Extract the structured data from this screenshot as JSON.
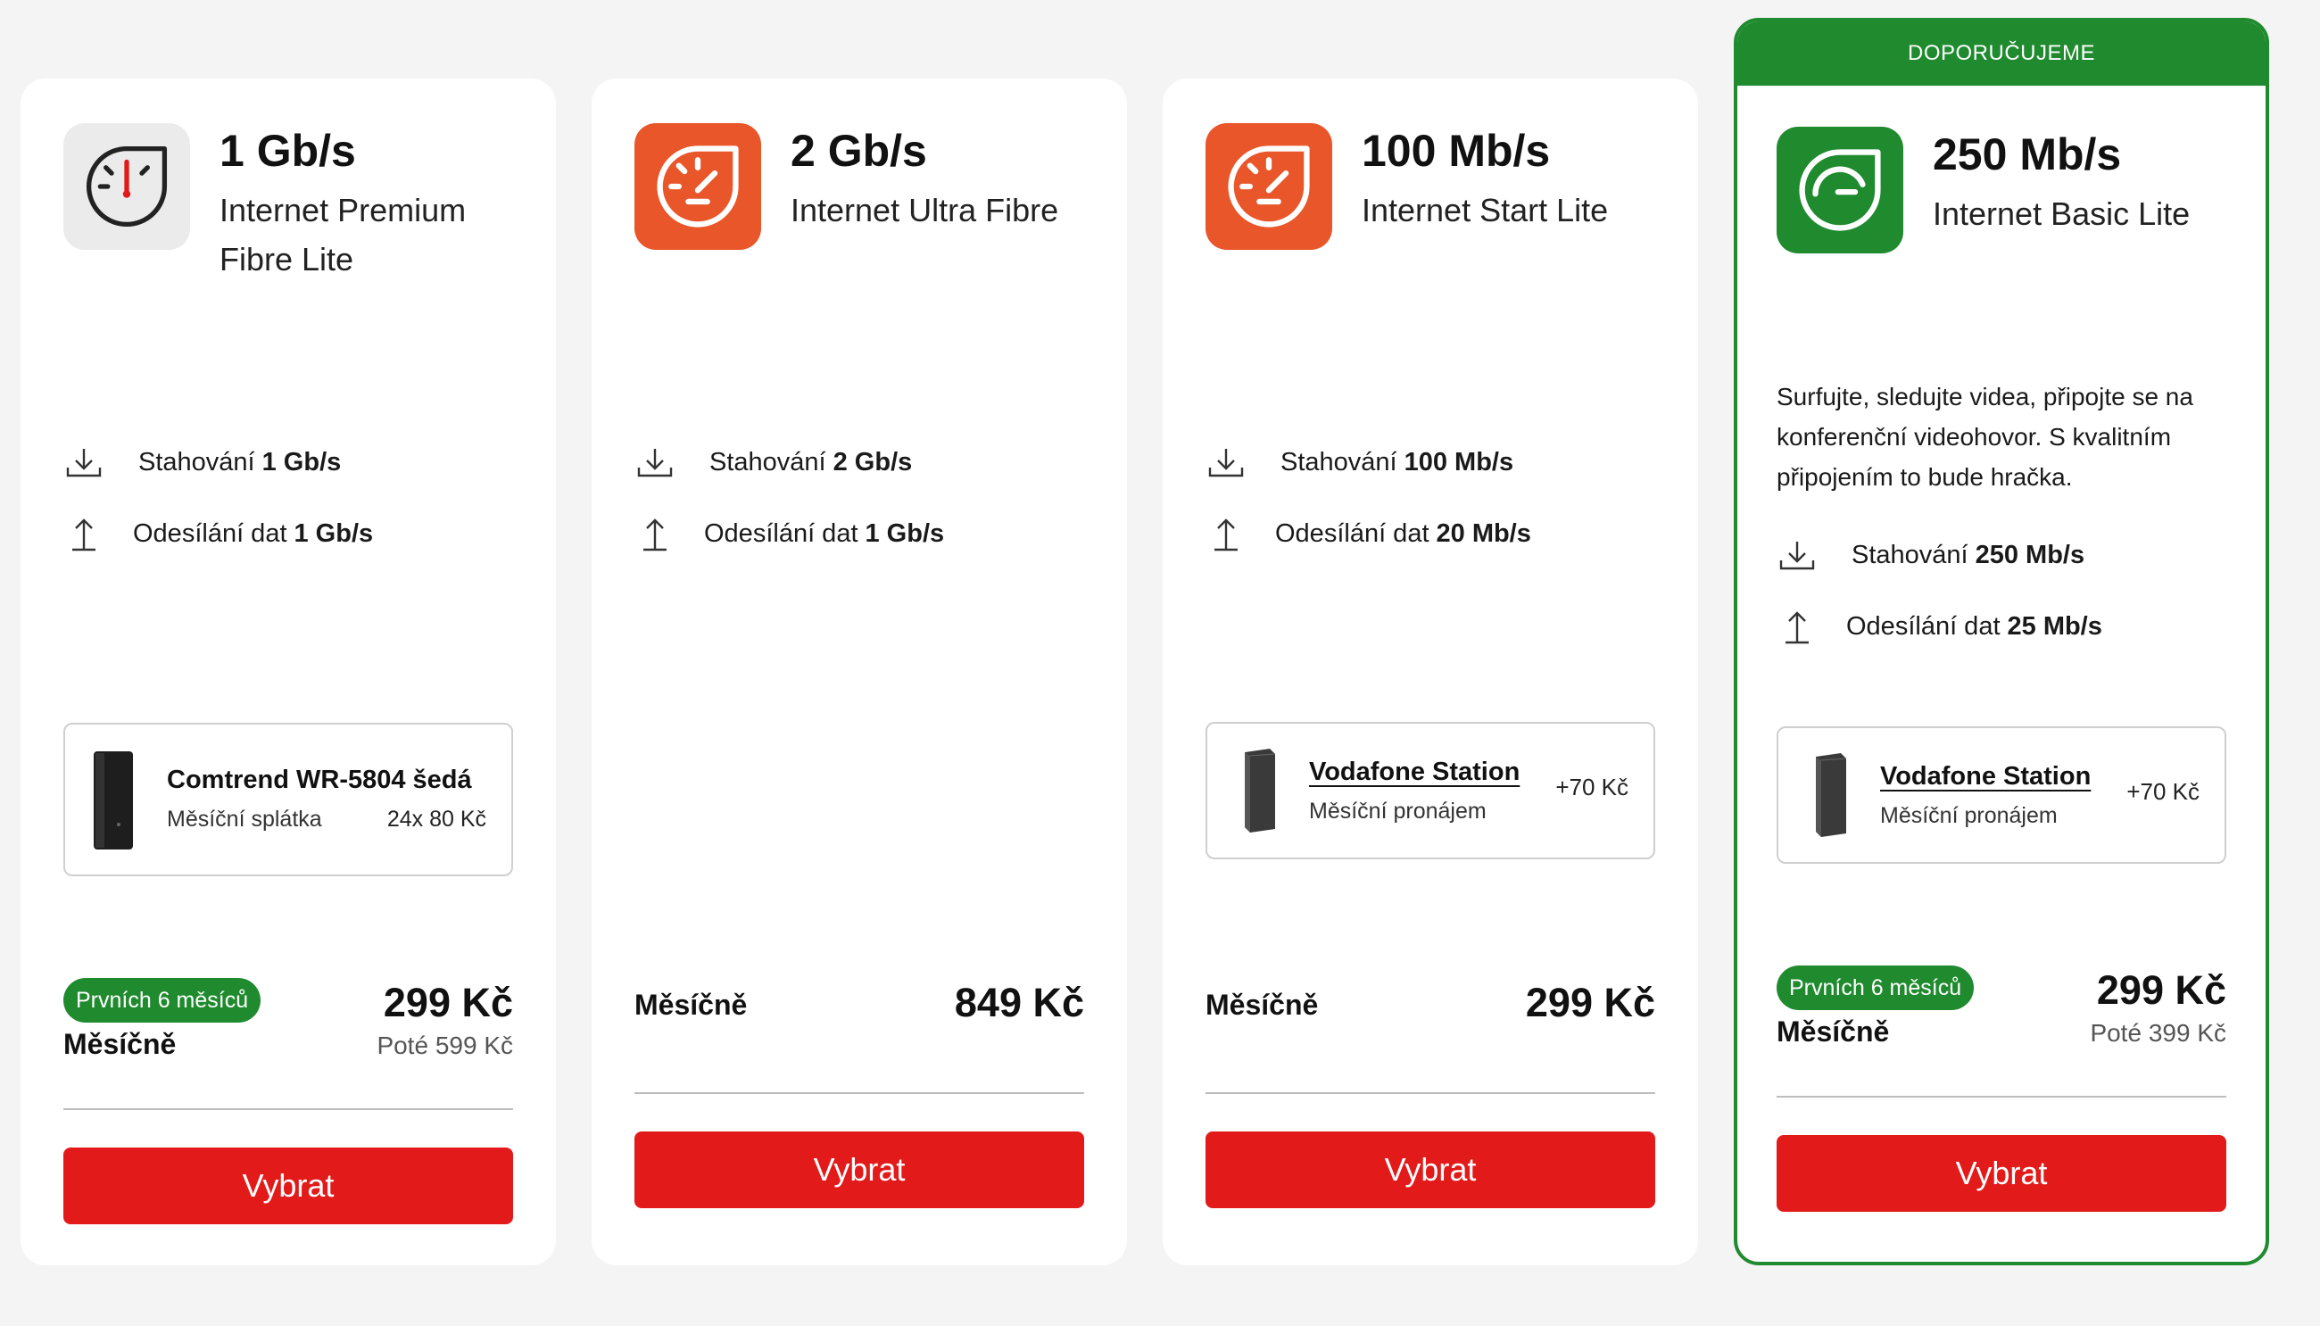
{
  "plans": [
    {
      "speed": "1 Gb/s",
      "name": "Internet Premium Fibre Lite",
      "download_label": "Stahování",
      "download_value": "1 Gb/s",
      "upload_label": "Odesílání dat",
      "upload_value": "1 Gb/s",
      "device": {
        "name": "Comtrend WR-5804 šedá",
        "sub": "Měsíční splátka",
        "price": "24x 80 Kč"
      },
      "badge": "Prvních 6 měsíců",
      "monthly_label": "Měsíčně",
      "price": "299 Kč",
      "after_price": "Poté 599 Kč",
      "button": "Vybrat"
    },
    {
      "speed": "2 Gb/s",
      "name": "Internet Ultra Fibre",
      "download_label": "Stahování",
      "download_value": "2 Gb/s",
      "upload_label": "Odesílání dat",
      "upload_value": "1 Gb/s",
      "monthly_label": "Měsíčně",
      "price": "849 Kč",
      "button": "Vybrat"
    },
    {
      "speed": "100 Mb/s",
      "name": "Internet Start Lite",
      "download_label": "Stahování",
      "download_value": "100 Mb/s",
      "upload_label": "Odesílání dat",
      "upload_value": "20 Mb/s",
      "device": {
        "name": "Vodafone Station",
        "sub": "Měsíční pronájem",
        "price": "+70 Kč"
      },
      "monthly_label": "Měsíčně",
      "price": "299 Kč",
      "button": "Vybrat"
    },
    {
      "recommended": "DOPORUČUJEME",
      "speed": "250 Mb/s",
      "name": "Internet Basic Lite",
      "description": "Surfujte, sledujte videa, připojte se na konferenční videohovor. S kvalitním připojením to bude hračka.",
      "download_label": "Stahování",
      "download_value": "250 Mb/s",
      "upload_label": "Odesílání dat",
      "upload_value": "25 Mb/s",
      "device": {
        "name": "Vodafone Station",
        "sub": "Měsíční pronájem",
        "price": "+70 Kč"
      },
      "badge": "Prvních 6 měsíců",
      "monthly_label": "Měsíčně",
      "price": "299 Kč",
      "after_price": "Poté 399 Kč",
      "button": "Vybrat"
    }
  ],
  "colors": {
    "accent_red": "#e21a1a",
    "green": "#1f8a2e",
    "orange": "#e8562a"
  },
  "icons": {
    "plan1": "speedometer-grey-icon",
    "plan2": "speedometer-orange-icon",
    "plan3": "speedometer-orange-icon",
    "plan4": "speedometer-green-icon",
    "download": "download-arrow-icon",
    "upload": "upload-arrow-icon"
  }
}
